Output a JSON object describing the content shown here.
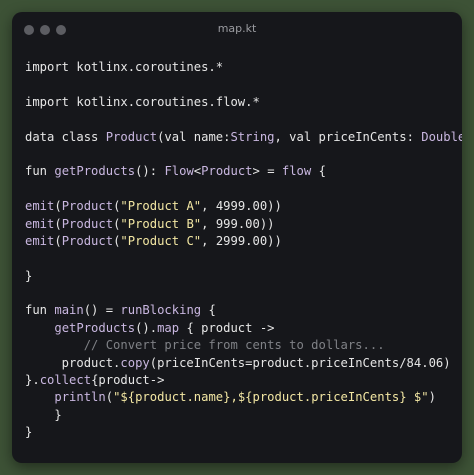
{
  "window": {
    "title": "map.kt"
  },
  "code": {
    "lines": [
      [
        {
          "t": "import kotlinx.coroutines.*",
          "c": "kw"
        }
      ],
      [],
      [
        {
          "t": "import kotlinx.coroutines.flow.*",
          "c": "kw"
        }
      ],
      [],
      [
        {
          "t": "data class ",
          "c": "kw"
        },
        {
          "t": "Product",
          "c": "tp"
        },
        {
          "t": "(val name:",
          "c": "kw"
        },
        {
          "t": "String",
          "c": "tp"
        },
        {
          "t": ", val priceInCents: ",
          "c": "kw"
        },
        {
          "t": "Double",
          "c": "tp"
        },
        {
          "t": ")",
          "c": "kw"
        }
      ],
      [],
      [
        {
          "t": "fun ",
          "c": "kw"
        },
        {
          "t": "getProducts",
          "c": "tp"
        },
        {
          "t": "(): ",
          "c": "kw"
        },
        {
          "t": "Flow",
          "c": "tp"
        },
        {
          "t": "<",
          "c": "kw"
        },
        {
          "t": "Product",
          "c": "tp"
        },
        {
          "t": "> = ",
          "c": "kw"
        },
        {
          "t": "flow",
          "c": "tp"
        },
        {
          "t": " {",
          "c": "kw"
        }
      ],
      [],
      [
        {
          "t": "emit",
          "c": "tp"
        },
        {
          "t": "(",
          "c": "kw"
        },
        {
          "t": "Product",
          "c": "tp"
        },
        {
          "t": "(",
          "c": "kw"
        },
        {
          "t": "\"Product A\"",
          "c": "st"
        },
        {
          "t": ", 4999.00))",
          "c": "kw"
        }
      ],
      [
        {
          "t": "emit",
          "c": "tp"
        },
        {
          "t": "(",
          "c": "kw"
        },
        {
          "t": "Product",
          "c": "tp"
        },
        {
          "t": "(",
          "c": "kw"
        },
        {
          "t": "\"Product B\"",
          "c": "st"
        },
        {
          "t": ", 999.00))",
          "c": "kw"
        }
      ],
      [
        {
          "t": "emit",
          "c": "tp"
        },
        {
          "t": "(",
          "c": "kw"
        },
        {
          "t": "Product",
          "c": "tp"
        },
        {
          "t": "(",
          "c": "kw"
        },
        {
          "t": "\"Product C\"",
          "c": "st"
        },
        {
          "t": ", 2999.00))",
          "c": "kw"
        }
      ],
      [],
      [
        {
          "t": "}",
          "c": "kw"
        }
      ],
      [],
      [
        {
          "t": "fun ",
          "c": "kw"
        },
        {
          "t": "main",
          "c": "tp"
        },
        {
          "t": "() = ",
          "c": "kw"
        },
        {
          "t": "runBlocking",
          "c": "tp"
        },
        {
          "t": " {",
          "c": "kw"
        }
      ],
      [
        {
          "t": "    ",
          "c": "kw"
        },
        {
          "t": "getProducts",
          "c": "tp"
        },
        {
          "t": "().",
          "c": "kw"
        },
        {
          "t": "map",
          "c": "tp"
        },
        {
          "t": " { product ->",
          "c": "kw"
        }
      ],
      [
        {
          "t": "        // Convert price from cents to dollars...",
          "c": "cm"
        }
      ],
      [
        {
          "t": "     product.",
          "c": "kw"
        },
        {
          "t": "copy",
          "c": "tp"
        },
        {
          "t": "(priceInCents=product.priceInCents/84.06)",
          "c": "kw"
        }
      ],
      [
        {
          "t": "}.",
          "c": "kw"
        },
        {
          "t": "collect",
          "c": "tp"
        },
        {
          "t": "{product->",
          "c": "kw"
        }
      ],
      [
        {
          "t": "    ",
          "c": "kw"
        },
        {
          "t": "println",
          "c": "tp"
        },
        {
          "t": "(",
          "c": "kw"
        },
        {
          "t": "\"${product.name},${product.priceInCents} $\"",
          "c": "st"
        },
        {
          "t": ")",
          "c": "kw"
        }
      ],
      [
        {
          "t": "    }",
          "c": "kw"
        }
      ],
      [
        {
          "t": "}",
          "c": "kw"
        }
      ]
    ]
  }
}
